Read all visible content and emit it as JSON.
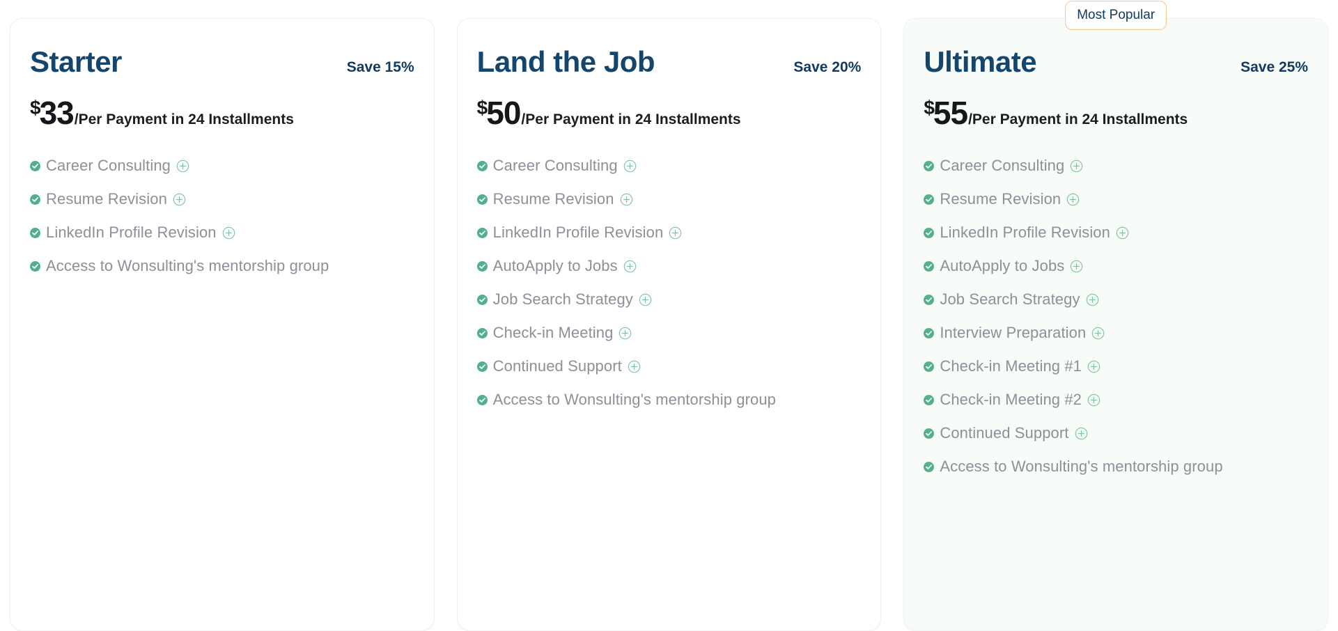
{
  "plans": [
    {
      "name": "Starter",
      "save_label": "Save 15%",
      "currency": "$",
      "amount": "33",
      "period": "/Per Payment in 24 Installments",
      "featured": false,
      "badge": null,
      "features": [
        {
          "label": "Career Consulting",
          "expandable": true
        },
        {
          "label": "Resume Revision",
          "expandable": true
        },
        {
          "label": "LinkedIn Profile Revision",
          "expandable": true
        },
        {
          "label": "Access to Wonsulting's mentorship group",
          "expandable": false
        }
      ]
    },
    {
      "name": "Land the Job",
      "save_label": "Save 20%",
      "currency": "$",
      "amount": "50",
      "period": "/Per Payment in 24 Installments",
      "featured": false,
      "badge": null,
      "features": [
        {
          "label": "Career Consulting",
          "expandable": true
        },
        {
          "label": "Resume Revision",
          "expandable": true
        },
        {
          "label": "LinkedIn Profile Revision",
          "expandable": true
        },
        {
          "label": "AutoApply to Jobs",
          "expandable": true
        },
        {
          "label": "Job Search Strategy",
          "expandable": true
        },
        {
          "label": "Check-in Meeting",
          "expandable": true
        },
        {
          "label": "Continued Support",
          "expandable": true
        },
        {
          "label": "Access to Wonsulting's mentorship group",
          "expandable": false
        }
      ]
    },
    {
      "name": "Ultimate",
      "save_label": "Save 25%",
      "currency": "$",
      "amount": "55",
      "period": "/Per Payment in 24 Installments",
      "featured": true,
      "badge": "Most Popular",
      "features": [
        {
          "label": "Career Consulting",
          "expandable": true
        },
        {
          "label": "Resume Revision",
          "expandable": true
        },
        {
          "label": "LinkedIn Profile Revision",
          "expandable": true
        },
        {
          "label": "AutoApply to Jobs",
          "expandable": true
        },
        {
          "label": "Job Search Strategy",
          "expandable": true
        },
        {
          "label": "Interview Preparation",
          "expandable": true
        },
        {
          "label": "Check-in Meeting #1",
          "expandable": true
        },
        {
          "label": "Check-in Meeting #2",
          "expandable": true
        },
        {
          "label": "Continued Support",
          "expandable": true
        },
        {
          "label": "Access to Wonsulting's mentorship group",
          "expandable": false
        }
      ]
    }
  ],
  "icons": {
    "check": "check-circle-icon",
    "plus": "plus-circle-icon"
  },
  "colors": {
    "plan_name": "#14466d",
    "save_text": "#14395f",
    "price": "#16171a",
    "feature_text": "#8b9099",
    "check_fill": "#54b08a",
    "plus_stroke": "#7fbfa4",
    "badge_border": "#f6c98a",
    "badge_text": "#103a5e",
    "featured_bg": "#f7fcf8",
    "card_border": "#f0f0f0"
  }
}
